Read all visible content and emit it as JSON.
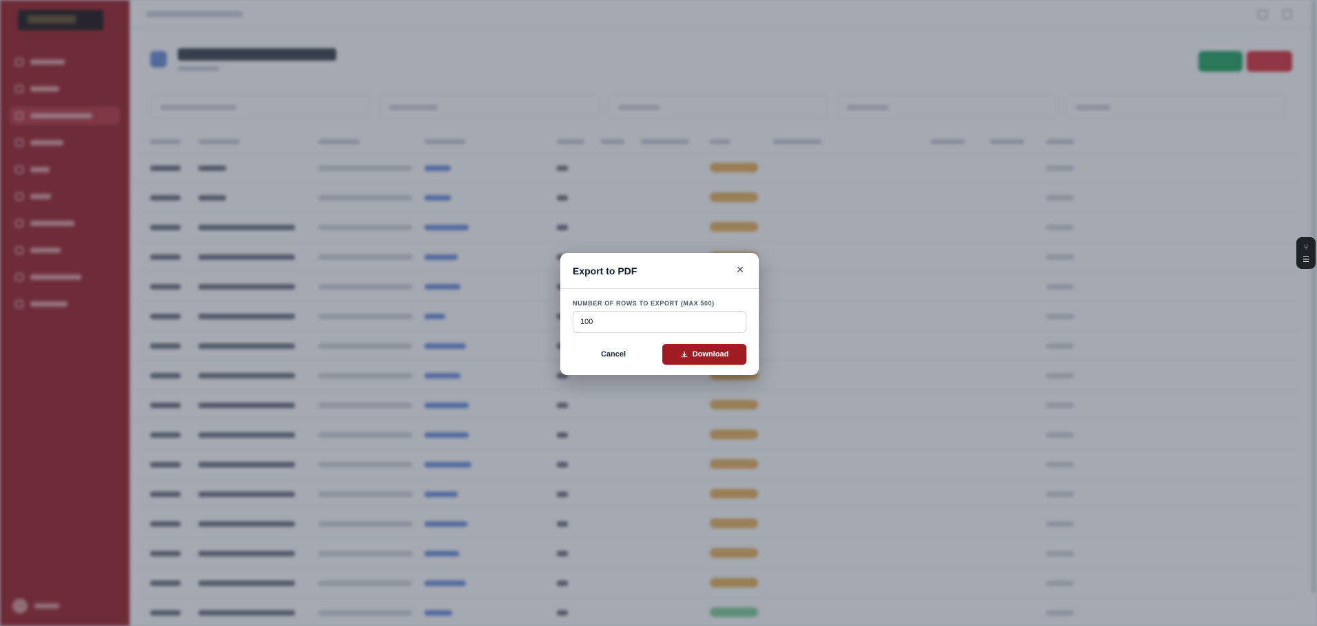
{
  "modal": {
    "title": "Export to PDF",
    "close_glyph": "✕",
    "field_label": "NUMBER OF ROWS TO EXPORT (MAX 500)",
    "field_value": "100",
    "cancel_label": "Cancel",
    "download_label": "Download"
  },
  "colors": {
    "sidebar": "#9b1c24",
    "primary_button": "#9f1c22",
    "overlay": "rgba(55,65,81,0.45)",
    "status_badge": "#e8b25c"
  },
  "icons": {
    "close": "close-icon",
    "download": "download-icon",
    "widget_top": "git-branch-icon",
    "widget_bottom": "list-icon"
  },
  "widget": {
    "top_glyph": "⑂",
    "bottom_glyph": "☰"
  }
}
